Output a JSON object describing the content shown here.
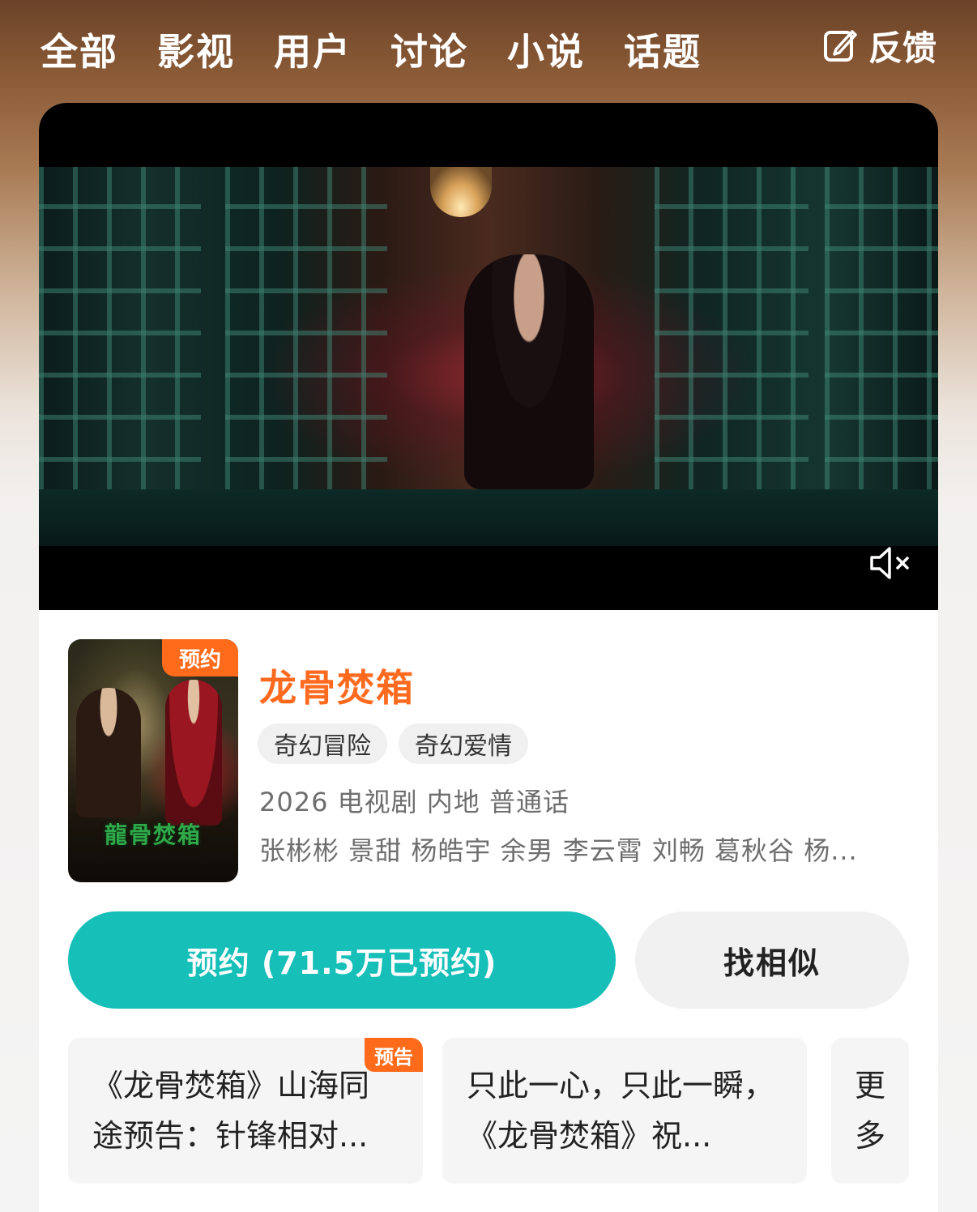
{
  "nav": {
    "tabs": [
      "全部",
      "影视",
      "用户",
      "讨论",
      "小说",
      "话题"
    ],
    "feedback_label": "反馈"
  },
  "player": {
    "mute_icon": "volume-mute-icon"
  },
  "show": {
    "poster_badge": "预约",
    "poster_title": "龍骨焚箱",
    "title": "龙骨焚箱",
    "tags": [
      "奇幻冒险",
      "奇幻爱情"
    ],
    "meta": "2026 电视剧 内地 普通话",
    "cast": "张彬彬 景甜 杨皓宇 余男 李云霄 刘畅 葛秋谷 杨..."
  },
  "actions": {
    "reserve_label": "预约 (71.5万已预约)",
    "similar_label": "找相似"
  },
  "related": {
    "items": [
      {
        "title": "《龙骨焚箱》山海同途预告：针锋相对...",
        "badge": "预告"
      },
      {
        "title": "只此一心，只此一瞬，《龙骨焚箱》祝...",
        "badge": ""
      }
    ],
    "more_label": "更多"
  },
  "colors": {
    "accent_orange": "#ff6a1f",
    "primary_teal": "#16bfb8"
  }
}
